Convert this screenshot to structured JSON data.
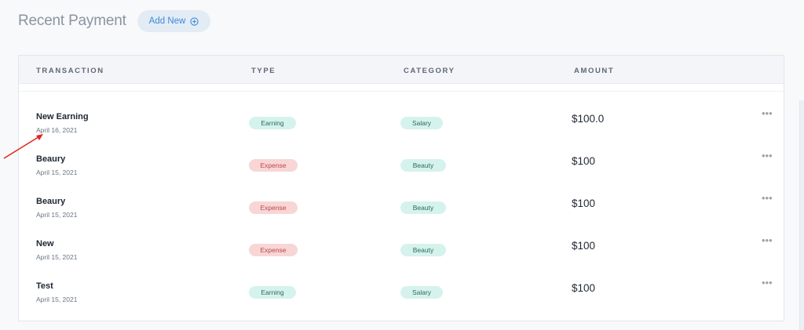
{
  "header": {
    "title": "Recent Payment",
    "add_button_label": "Add New"
  },
  "table": {
    "columns": [
      "TRANSACTION",
      "TYPE",
      "CATEGORY",
      "AMOUNT"
    ],
    "rows": [
      {
        "title": "New Earning",
        "date": "April 16, 2021",
        "type": "Earning",
        "category": "Salary",
        "amount": "$100.0",
        "more": "•••"
      },
      {
        "title": "Beaury",
        "date": "April 15, 2021",
        "type": "Expense",
        "category": "Beauty",
        "amount": "$100",
        "more": "•••"
      },
      {
        "title": "Beaury",
        "date": "April 15, 2021",
        "type": "Expense",
        "category": "Beauty",
        "amount": "$100",
        "more": "•••"
      },
      {
        "title": "New",
        "date": "April 15, 2021",
        "type": "Expense",
        "category": "Beauty",
        "amount": "$100",
        "more": "•••"
      },
      {
        "title": "Test",
        "date": "April 15, 2021",
        "type": "Earning",
        "category": "Salary",
        "amount": "$100",
        "more": "•••"
      }
    ]
  },
  "colors": {
    "accent": "#3d8ad6",
    "earning_bg": "#d5f3ec",
    "expense_bg": "#f8d6d6",
    "annotation_arrow": "#e0281f"
  },
  "icons": {
    "add": "plus-circle-icon",
    "row_menu": "more-horizontal-icon",
    "annotation": "red-arrow-icon"
  }
}
